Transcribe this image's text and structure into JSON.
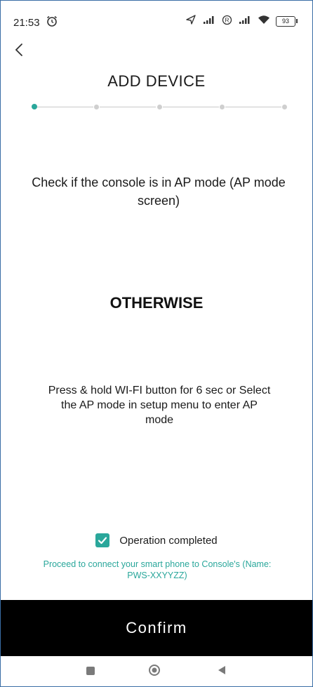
{
  "status_bar": {
    "time": "21:53",
    "battery": "93",
    "icons": [
      "alarm-icon",
      "location-arrow-icon",
      "signal-icon",
      "registered-icon",
      "signal-icon",
      "wifi-icon",
      "battery-icon"
    ]
  },
  "header": {
    "title": "ADD DEVICE",
    "back_icon": "chevron-left-icon"
  },
  "stepper": {
    "total_steps": 5,
    "current_step": 1,
    "colors": {
      "active": "#2aa79b",
      "inactive": "#cfcfcf"
    }
  },
  "content": {
    "instruction": "Check if the console is in AP mode (AP mode screen)",
    "otherwise": "OTHERWISE",
    "alt_instruction": "Press & hold WI-FI button for 6 sec or Select the AP mode in setup menu to enter AP mode"
  },
  "operation": {
    "checked": true,
    "label": "Operation completed",
    "hint": "Proceed to connect your smart phone to Console's (Name: PWS-XXYYZZ)"
  },
  "confirm": {
    "label": "Confirm"
  },
  "nav_bar": {
    "icons": [
      "square-icon",
      "circle-icon",
      "triangle-back-icon"
    ]
  },
  "colors": {
    "accent": "#2aa79b",
    "confirm_bg": "#000000",
    "frame_border": "#3a6ea5"
  }
}
